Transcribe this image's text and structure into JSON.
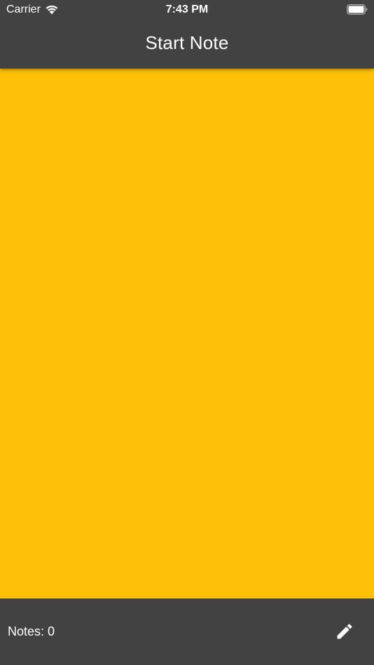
{
  "status_bar": {
    "carrier": "Carrier",
    "time": "7:43 PM",
    "wifi_icon": "wifi-icon",
    "battery_icon": "battery-full-icon"
  },
  "nav": {
    "title": "Start Note"
  },
  "bottom_bar": {
    "notes_count": "Notes: 0",
    "edit_icon": "pencil-icon"
  },
  "colors": {
    "bar": "#424242",
    "content": "#FFC107",
    "text": "#ffffff"
  }
}
